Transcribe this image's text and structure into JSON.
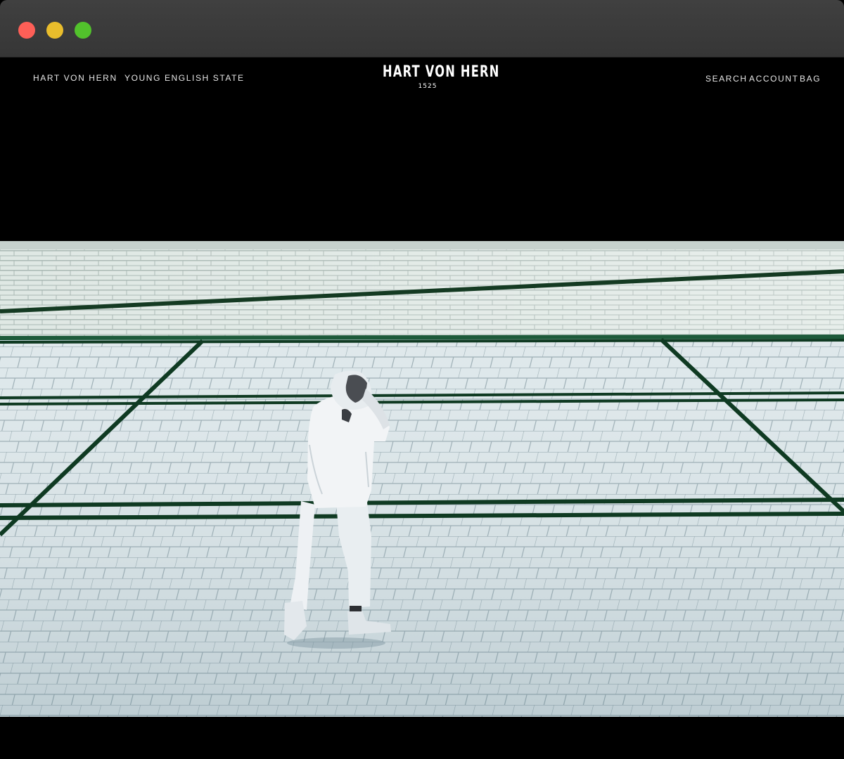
{
  "window": {
    "controls": [
      "close",
      "minimize",
      "maximize"
    ]
  },
  "header": {
    "left_links": [
      "HART VON HERN",
      "YOUNG ENGLISH STATE"
    ],
    "logo": {
      "name": "HART VON HERN",
      "year": "1525"
    },
    "right_links": {
      "search": "SEARCH",
      "account": "ACCOUNT",
      "bag": "BAG"
    }
  },
  "hero": {
    "media": "video-frame",
    "scene": "person-in-white-tracksuit-walking-in-empty-tiled-pool"
  },
  "colors": {
    "background": "#000000",
    "nav_text": "#e8e8e8",
    "tile": "#dfe9ec",
    "pool_line": "#0f3a22",
    "close": "#fe5f57",
    "minimize": "#e9bd2c",
    "maximize": "#52c22c"
  }
}
